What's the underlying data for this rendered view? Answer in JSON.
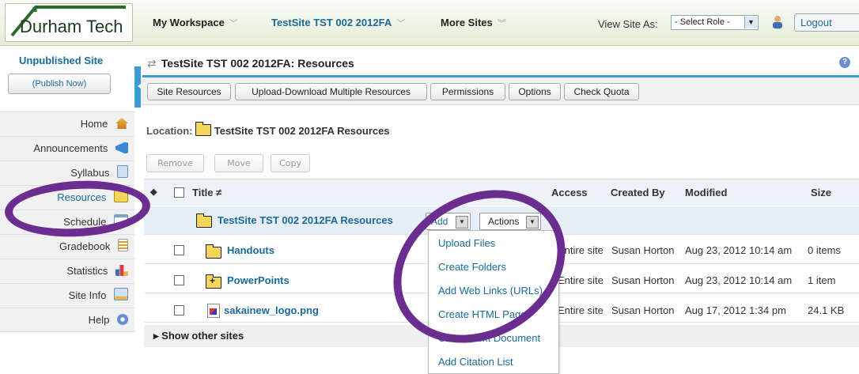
{
  "header": {
    "logo_text": "Durham Tech",
    "nav": [
      {
        "label": "My Workspace"
      },
      {
        "label": "TestSite TST 002 2012FA"
      },
      {
        "label": "More Sites"
      }
    ],
    "view_site_as_label": "View Site As:",
    "role_select_value": "- Select Role -",
    "logout_label": "Logout"
  },
  "sidebar": {
    "status": "Unpublished Site",
    "publish_label": "(Publish Now)",
    "items": [
      {
        "label": "Home",
        "icon": "home-icon"
      },
      {
        "label": "Announcements",
        "icon": "megaphone-icon"
      },
      {
        "label": "Syllabus",
        "icon": "syllabus-icon"
      },
      {
        "label": "Resources",
        "icon": "folder-icon"
      },
      {
        "label": "Schedule",
        "icon": "calendar-icon"
      },
      {
        "label": "Gradebook",
        "icon": "gradebook-icon"
      },
      {
        "label": "Statistics",
        "icon": "bar-chart-icon"
      },
      {
        "label": "Site Info",
        "icon": "site-info-icon"
      },
      {
        "label": "Help",
        "icon": "help-icon"
      }
    ]
  },
  "main": {
    "title": "TestSite TST 002 2012FA: Resources",
    "tabs": [
      "Site Resources",
      "Upload-Download Multiple Resources",
      "Permissions",
      "Options",
      "Check Quota"
    ],
    "location_label": "Location:",
    "location_value": "TestSite TST 002 2012FA Resources",
    "actions": [
      "Remove",
      "Move",
      "Copy"
    ],
    "columns": {
      "title": "Title ≠",
      "access": "Access",
      "created_by": "Created By",
      "modified": "Modified",
      "size": "Size"
    },
    "root_folder": "TestSite TST 002 2012FA Resources",
    "add_label": "Add",
    "actions_label": "Actions",
    "rows": [
      {
        "name": "Handouts",
        "access": "Entire site",
        "created_by": "Susan Horton",
        "modified": "Aug 23, 2012 10:14 am",
        "size": "0 items"
      },
      {
        "name": "PowerPoints",
        "access": "Entire site",
        "created_by": "Susan Horton",
        "modified": "Aug 23, 2012 10:14 am",
        "size": "1 item"
      },
      {
        "name": "sakainew_logo.png",
        "access": "Entire site",
        "created_by": "Susan Horton",
        "modified": "Aug 17, 2012 1:34 pm",
        "size": "24.1 KB"
      }
    ],
    "add_menu": [
      "Upload Files",
      "Create Folders",
      "Add Web Links (URLs)",
      "Create HTML Page",
      "Create Text Document",
      "Add Citation List"
    ],
    "show_other_sites": "Show other sites"
  },
  "colors": {
    "accent": "#3b9ad8",
    "link": "#1a6a9b",
    "highlight_ring": "#6b2d8f"
  }
}
